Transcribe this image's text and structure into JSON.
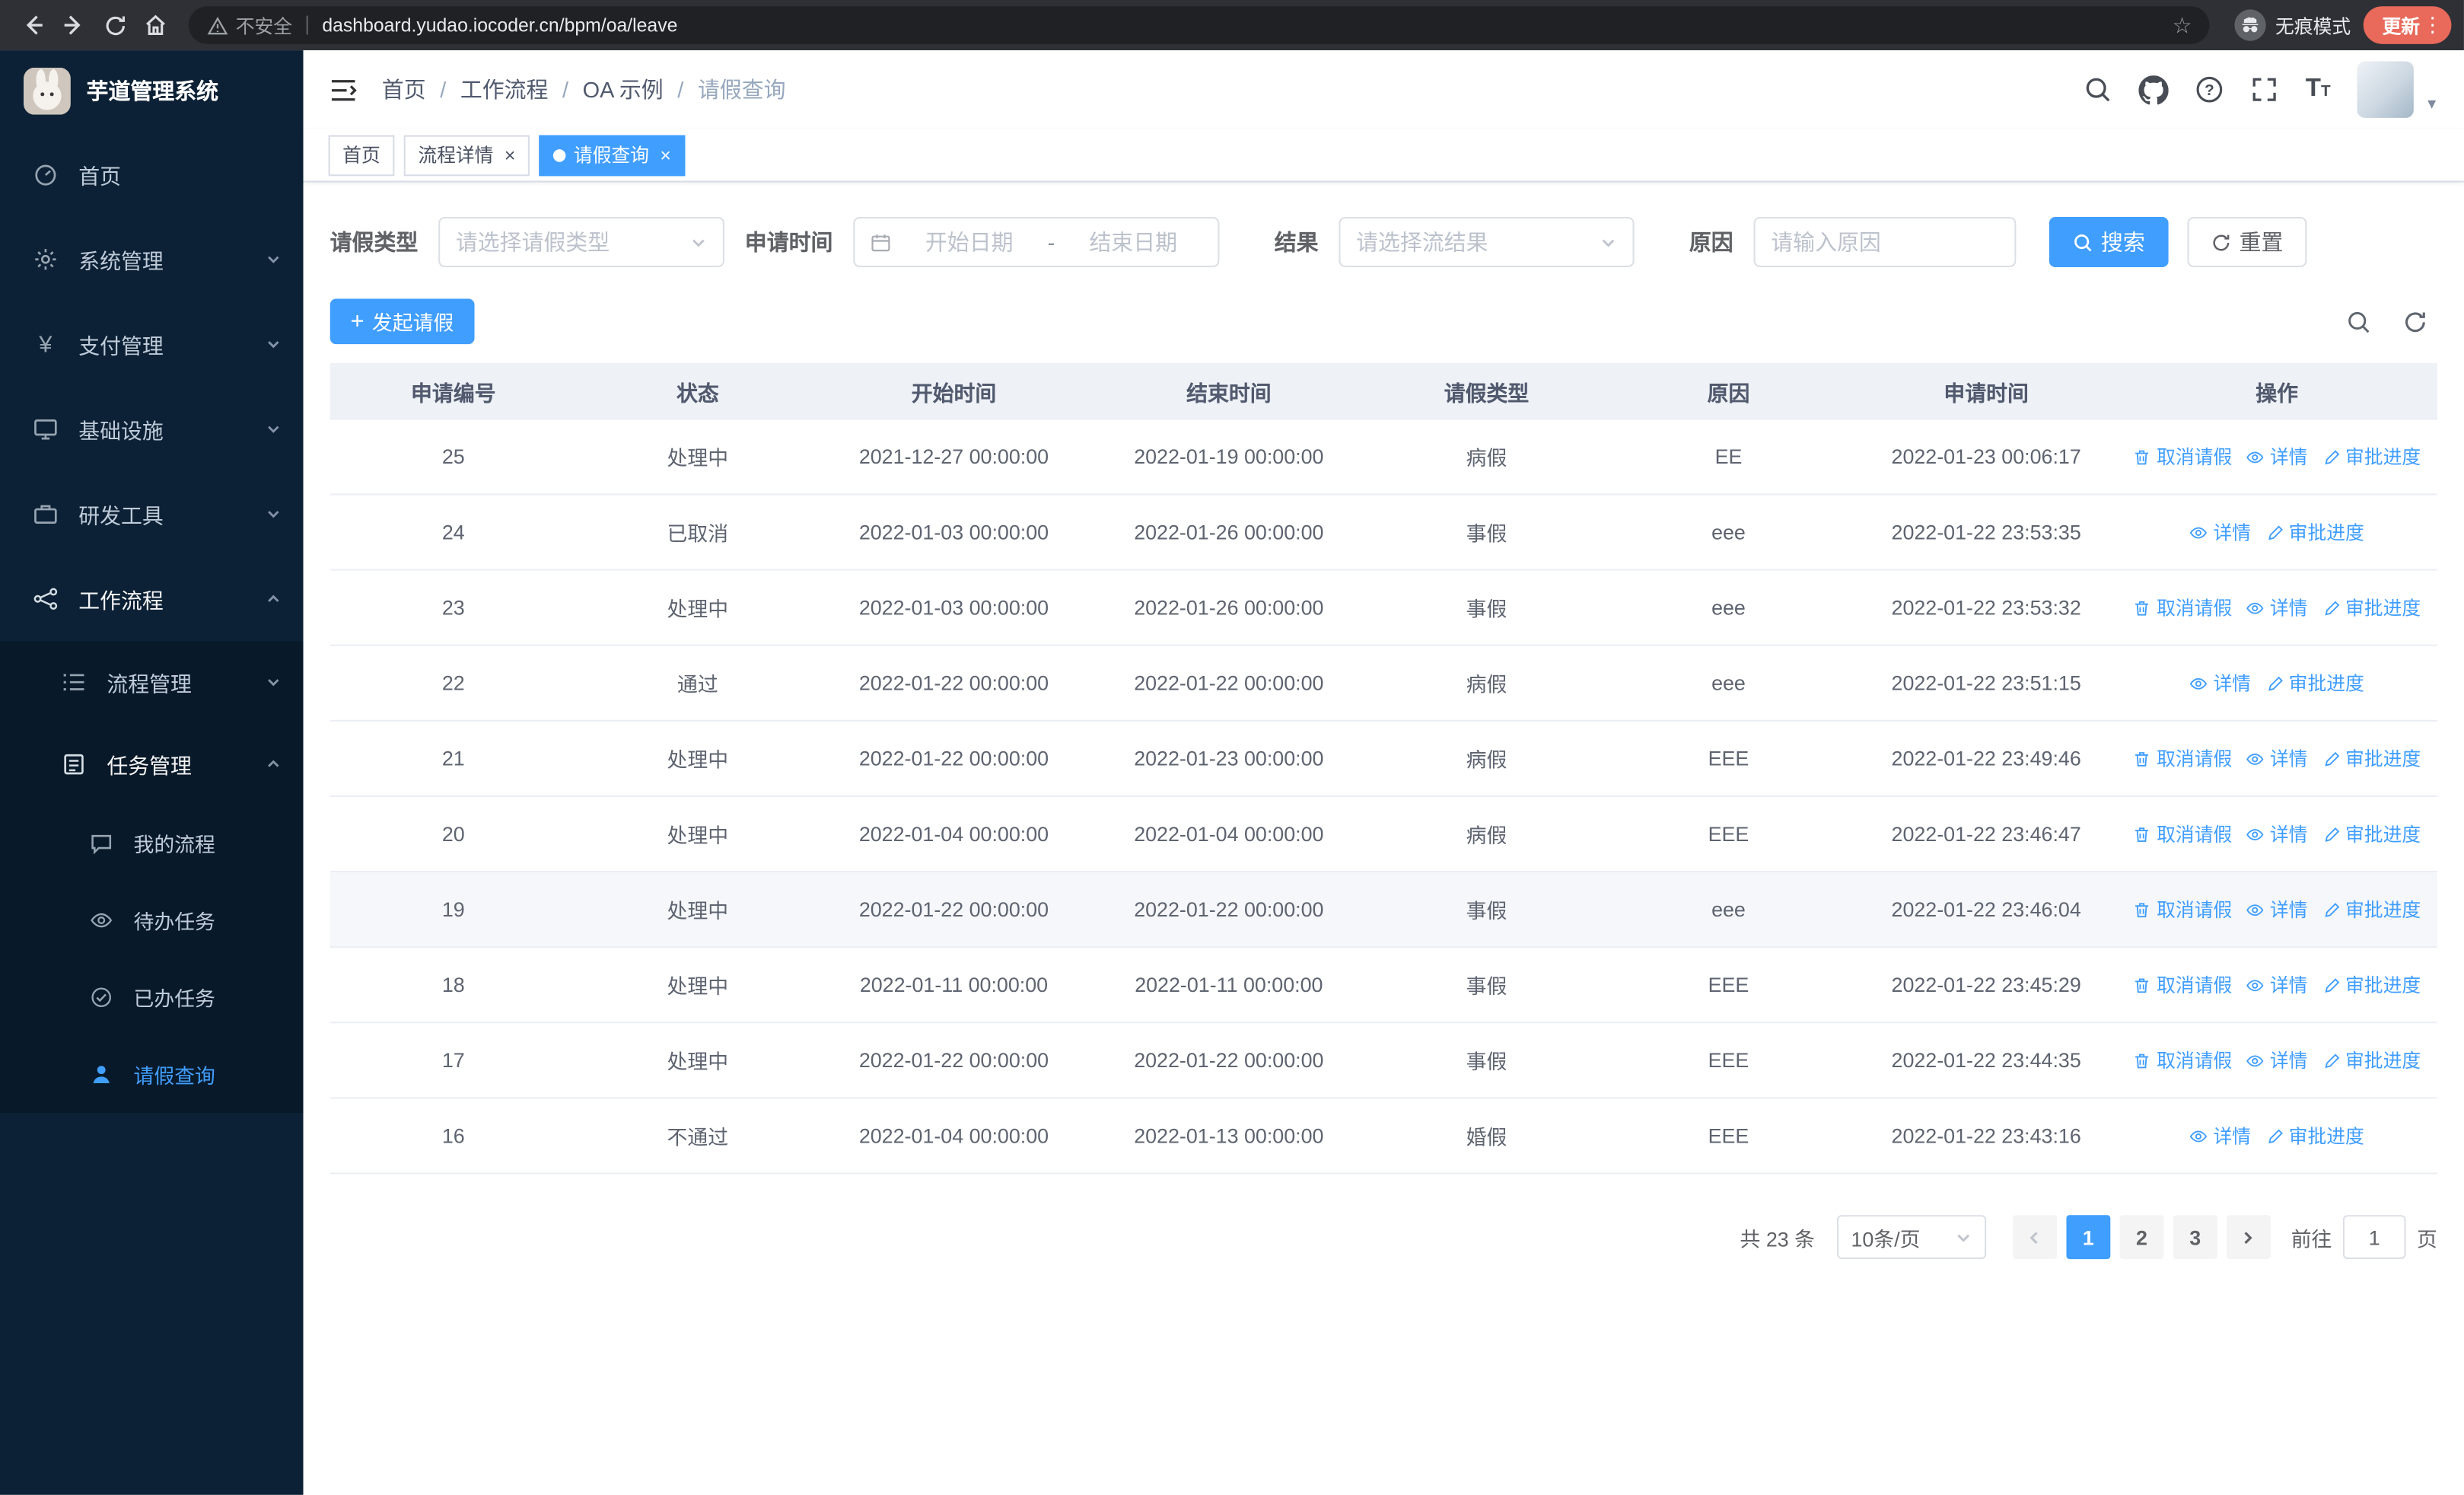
{
  "browser": {
    "security_label": "不安全",
    "url": "dashboard.yudao.iocoder.cn/bpm/oa/leave",
    "incognito_label": "无痕模式",
    "update_label": "更新"
  },
  "sidebar": {
    "brand": "芋道管理系统",
    "items": [
      {
        "label": "首页"
      },
      {
        "label": "系统管理"
      },
      {
        "label": "支付管理"
      },
      {
        "label": "基础设施"
      },
      {
        "label": "研发工具"
      },
      {
        "label": "工作流程",
        "expanded": true
      },
      {
        "label": "流程管理"
      },
      {
        "label": "任务管理",
        "expanded": true
      },
      {
        "label": "我的流程"
      },
      {
        "label": "待办任务"
      },
      {
        "label": "已办任务"
      },
      {
        "label": "请假查询",
        "active": true
      }
    ]
  },
  "header": {
    "breadcrumb": [
      "首页",
      "工作流程",
      "OA 示例",
      "请假查询"
    ]
  },
  "tabs": [
    {
      "label": "首页",
      "closable": false,
      "active": false
    },
    {
      "label": "流程详情",
      "closable": true,
      "active": false
    },
    {
      "label": "请假查询",
      "closable": true,
      "active": true
    }
  ],
  "filters": {
    "leave_type": {
      "label": "请假类型",
      "placeholder": "请选择请假类型"
    },
    "apply_time": {
      "label": "申请时间",
      "start_placeholder": "开始日期",
      "separator": "-",
      "end_placeholder": "结束日期"
    },
    "result": {
      "label": "结果",
      "placeholder": "请选择流结果"
    },
    "reason": {
      "label": "原因",
      "placeholder": "请输入原因"
    },
    "search_label": "搜索",
    "reset_label": "重置"
  },
  "toolbar": {
    "create_label": "发起请假"
  },
  "table": {
    "columns": [
      "申请编号",
      "状态",
      "开始时间",
      "结束时间",
      "请假类型",
      "原因",
      "申请时间",
      "操作"
    ],
    "ops": {
      "cancel": "取消请假",
      "detail": "详情",
      "progress": "审批进度"
    },
    "rows": [
      {
        "id": "25",
        "status": "处理中",
        "start": "2021-12-27 00:00:00",
        "end": "2022-01-19 00:00:00",
        "type": "病假",
        "reason": "EE",
        "applied": "2022-01-23 00:06:17",
        "cancellable": true,
        "highlight": false
      },
      {
        "id": "24",
        "status": "已取消",
        "start": "2022-01-03 00:00:00",
        "end": "2022-01-26 00:00:00",
        "type": "事假",
        "reason": "eee",
        "applied": "2022-01-22 23:53:35",
        "cancellable": false,
        "highlight": false
      },
      {
        "id": "23",
        "status": "处理中",
        "start": "2022-01-03 00:00:00",
        "end": "2022-01-26 00:00:00",
        "type": "事假",
        "reason": "eee",
        "applied": "2022-01-22 23:53:32",
        "cancellable": true,
        "highlight": false
      },
      {
        "id": "22",
        "status": "通过",
        "start": "2022-01-22 00:00:00",
        "end": "2022-01-22 00:00:00",
        "type": "病假",
        "reason": "eee",
        "applied": "2022-01-22 23:51:15",
        "cancellable": false,
        "highlight": false
      },
      {
        "id": "21",
        "status": "处理中",
        "start": "2022-01-22 00:00:00",
        "end": "2022-01-23 00:00:00",
        "type": "病假",
        "reason": "EEE",
        "applied": "2022-01-22 23:49:46",
        "cancellable": true,
        "highlight": false
      },
      {
        "id": "20",
        "status": "处理中",
        "start": "2022-01-04 00:00:00",
        "end": "2022-01-04 00:00:00",
        "type": "病假",
        "reason": "EEE",
        "applied": "2022-01-22 23:46:47",
        "cancellable": true,
        "highlight": false
      },
      {
        "id": "19",
        "status": "处理中",
        "start": "2022-01-22 00:00:00",
        "end": "2022-01-22 00:00:00",
        "type": "事假",
        "reason": "eee",
        "applied": "2022-01-22 23:46:04",
        "cancellable": true,
        "highlight": true
      },
      {
        "id": "18",
        "status": "处理中",
        "start": "2022-01-11 00:00:00",
        "end": "2022-01-11 00:00:00",
        "type": "事假",
        "reason": "EEE",
        "applied": "2022-01-22 23:45:29",
        "cancellable": true,
        "highlight": false
      },
      {
        "id": "17",
        "status": "处理中",
        "start": "2022-01-22 00:00:00",
        "end": "2022-01-22 00:00:00",
        "type": "事假",
        "reason": "EEE",
        "applied": "2022-01-22 23:44:35",
        "cancellable": true,
        "highlight": false
      },
      {
        "id": "16",
        "status": "不通过",
        "start": "2022-01-04 00:00:00",
        "end": "2022-01-13 00:00:00",
        "type": "婚假",
        "reason": "EEE",
        "applied": "2022-01-22 23:43:16",
        "cancellable": false,
        "highlight": false
      }
    ]
  },
  "pagination": {
    "total_label": "共 23 条",
    "page_size_label": "10条/页",
    "pages": [
      "1",
      "2",
      "3"
    ],
    "active_page": "1",
    "goto_label": "前往",
    "goto_value": "1",
    "unit_label": "页"
  },
  "colors": {
    "primary": "#409eff",
    "sidebar_bg": "#0c2135",
    "submenu_bg": "#081929",
    "table_header_bg": "#eef1f6",
    "update_pill": "#e9695a"
  }
}
